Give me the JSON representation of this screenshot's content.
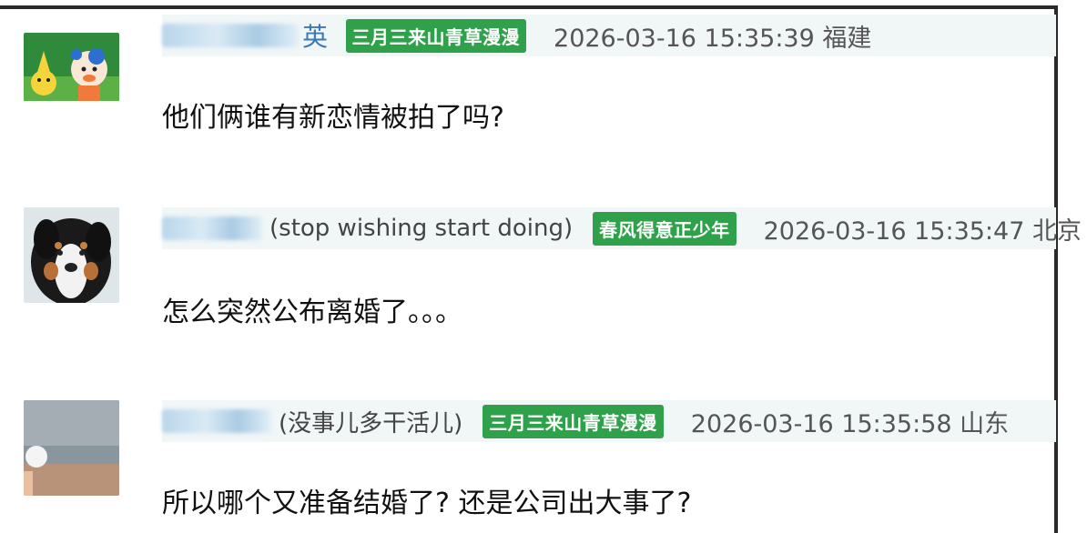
{
  "comments": [
    {
      "username_visible": "英",
      "nickname": "",
      "badge": "三月三来山青草漫漫",
      "time": "2026-03-16 15:35:39",
      "location": "福建",
      "text": "他们俩谁有新恋情被拍了吗?",
      "avatar": "pikachu-cartoon-avatar"
    },
    {
      "username_visible": "路 力",
      "nickname": "(stop wishing start doing)",
      "badge": "春风得意正少年",
      "time": "2026-03-16 15:35:47",
      "location": "北京",
      "text": "怎么突然公布离婚了。。。",
      "avatar": "dog-photo-avatar"
    },
    {
      "username_visible": "",
      "nickname": "(没事儿多干活儿)",
      "badge": "三月三来山青草漫漫",
      "time": "2026-03-16 15:35:58",
      "location": "山东",
      "text": "所以哪个又准备结婚了? 还是公司出大事了?",
      "avatar": "grey-photo-avatar"
    }
  ]
}
